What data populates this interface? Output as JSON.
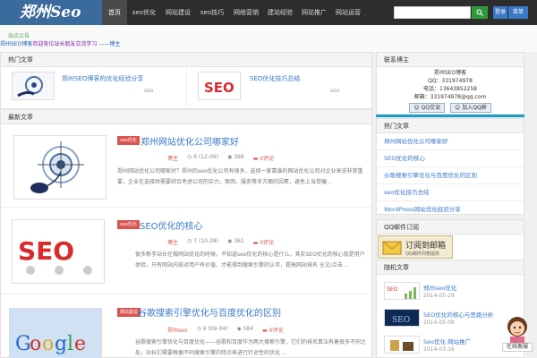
{
  "header": {
    "logo": "郑州Seo",
    "nav": [
      "首页",
      "seo优化",
      "网站建设",
      "seo技巧",
      "网络营销",
      "建站经验",
      "网站推广",
      "网站运营"
    ],
    "search_placeholder": "",
    "user_label": "登录",
    "menu_label": "菜单"
  },
  "notice": {
    "title": "站点公告",
    "text_blue": "郑州SEO博客",
    "text_purple": "欢迎各位站长朋友交流学习",
    "text_tail": " ——博主"
  },
  "hot_section": {
    "title": "热门文章",
    "items": [
      {
        "title": "郑州SEO博客的优化经验分享",
        "meta": "seo"
      },
      {
        "title": "SEO优化技巧总结",
        "meta": "seo"
      }
    ]
  },
  "latest": {
    "title": "最新文章",
    "posts": [
      {
        "tag": "seo优化",
        "title": "郑州网站优化公司哪家好",
        "author": "博主",
        "views": "6",
        "date": "(12-09)",
        "likes": "398",
        "comments": "0评论",
        "excerpt": "郑州网站优化公司哪家好？郑州的seo优化公司有很多，选择一家靠谱的网站优化公司对企业来说非常重要，企业在选择时需要综合考虑公司的实力、案例、服务等多方面的因素，避免上当受骗...",
        "thumb": "target"
      },
      {
        "tag": "seo优化",
        "title": "SEO优化的核心",
        "author": "博主",
        "views": "7",
        "date": "(10-28)",
        "likes": "361",
        "comments": "0评论",
        "excerpt": "很多新手站长在做网站优化的时候，不知道seo优化的核心是什么，其实SEO优化的核心就是用户体验，只有网站内容对用户有价值，才能得到搜索引擎的认可，提高网站排名 全文/点击 ...",
        "thumb": "seo"
      },
      {
        "tag": "网站建设",
        "title": "谷歌搜索引擎优化与百度优化的区别",
        "author": "郑州seo",
        "views": "9",
        "date": "(09-04)",
        "likes": "584",
        "comments": "0评论",
        "excerpt": "谷歌搜索引擎优化与百度优化——谷歌和百度作为两大搜索引擎，它们的排名算法有着很多不同之处，站长们需要根据不同搜索引擎的特点来进行针对性的优化 ...",
        "thumb": "google"
      }
    ]
  },
  "sidebar": {
    "info_title": "联系博主",
    "info_lines": [
      "郑州SEO博客",
      "QQ：331974978",
      "电话：13643852258",
      "邮箱：331974978@qq.com"
    ],
    "qq_chat": "QQ交谈",
    "qq_group": "加入QQ群",
    "hot_title": "热门文章",
    "hot_list": [
      "郑州网站优化公司哪家好",
      "SEO优化的核心",
      "谷歌搜索引擎优化与百度优化的区别",
      "seo优化技巧总结",
      "WordPress网站优化经验分享"
    ],
    "sub_title": "QQ邮件订阅",
    "sub_label": "订阅到邮箱",
    "sub_sub": "QQ邮件列表提供",
    "random_title": "随机文章",
    "random": [
      {
        "title": "郑州seo优化",
        "date": "2014-05-29"
      },
      {
        "title": "SEO优化的核心与思路分析",
        "date": "2014-05-09"
      },
      {
        "title": "Seo优化 网站推广",
        "date": "2014-03-16"
      }
    ],
    "service_label": "在线客服"
  }
}
